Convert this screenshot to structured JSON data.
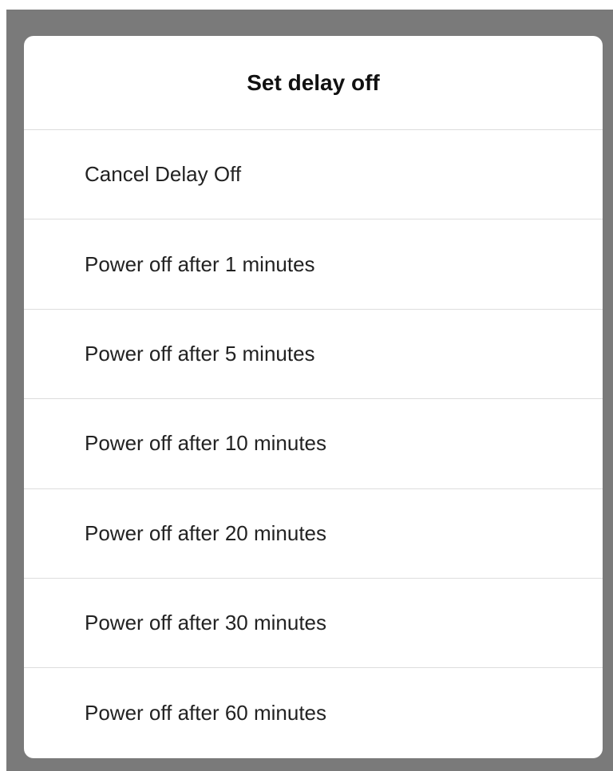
{
  "dialog": {
    "title": "Set delay off",
    "options": [
      {
        "label": "Cancel Delay Off"
      },
      {
        "label": "Power off after 1 minutes"
      },
      {
        "label": "Power off after 5 minutes"
      },
      {
        "label": "Power off after 10 minutes"
      },
      {
        "label": "Power off after 20 minutes"
      },
      {
        "label": "Power off after 30 minutes"
      },
      {
        "label": "Power off after 60 minutes"
      }
    ]
  },
  "colors": {
    "overlay": "#7a7a7a",
    "sheet": "#ffffff",
    "divider": "#dddddd"
  }
}
